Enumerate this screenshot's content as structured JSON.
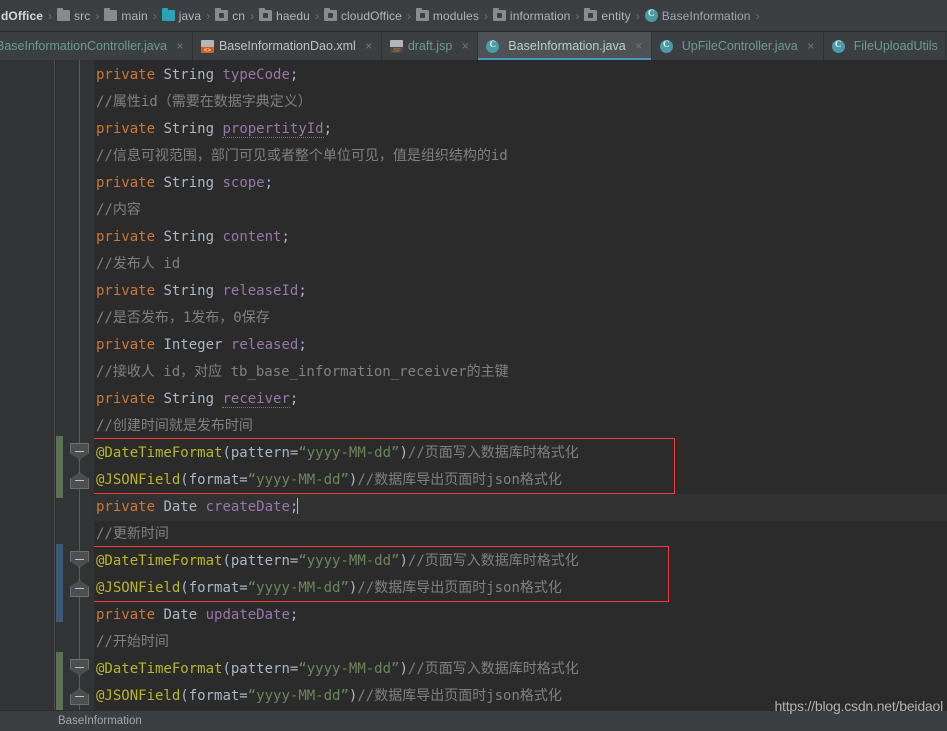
{
  "breadcrumb": {
    "items": [
      {
        "label": "dOffice",
        "icon": "folder-icon",
        "kind": "text"
      },
      {
        "label": "src",
        "icon": "folder-icon",
        "kind": "folder"
      },
      {
        "label": "main",
        "icon": "folder-icon",
        "kind": "folder"
      },
      {
        "label": "java",
        "icon": "source-folder-icon",
        "kind": "source"
      },
      {
        "label": "cn",
        "icon": "package-icon",
        "kind": "package"
      },
      {
        "label": "haedu",
        "icon": "package-icon",
        "kind": "package"
      },
      {
        "label": "cloudOffice",
        "icon": "package-icon",
        "kind": "package"
      },
      {
        "label": "modules",
        "icon": "package-icon",
        "kind": "package"
      },
      {
        "label": "information",
        "icon": "package-icon",
        "kind": "package"
      },
      {
        "label": "entity",
        "icon": "package-icon",
        "kind": "package"
      },
      {
        "label": "BaseInformation",
        "icon": "java-class-icon",
        "kind": "class"
      }
    ],
    "separator": "›"
  },
  "tabs": [
    {
      "label": "BaseInformationController.java",
      "icon": "java-class-icon",
      "type": "java",
      "active": false,
      "close": "×",
      "truncated": true
    },
    {
      "label": "BaseInformationDao.xml",
      "icon": "xml-file-icon",
      "type": "xml",
      "active": false,
      "close": "×"
    },
    {
      "label": "draft.jsp",
      "icon": "jsp-file-icon",
      "type": "jsp",
      "active": false,
      "close": "×"
    },
    {
      "label": "BaseInformation.java",
      "icon": "java-class-icon",
      "type": "java",
      "active": true,
      "close": "×"
    },
    {
      "label": "UpFileController.java",
      "icon": "java-class-icon",
      "type": "java",
      "active": false,
      "close": "×"
    },
    {
      "label": "FileUploadUtils",
      "icon": "java-class-icon",
      "type": "java",
      "active": false,
      "close": ""
    }
  ],
  "code": {
    "lines": [
      {
        "i": 0,
        "type": "field",
        "kw": "private",
        "typ": "String",
        "name": "typeCode",
        "semi": ";"
      },
      {
        "i": 1,
        "type": "comment",
        "text": "//属性id（需要在数据字典定义）"
      },
      {
        "i": 2,
        "type": "field",
        "kw": "private",
        "typ": "String",
        "name": "propertityId",
        "semi": ";",
        "spellwarn": true
      },
      {
        "i": 3,
        "type": "comment",
        "text": "//信息可视范围，部门可见或者整个单位可见，值是组织结构的id"
      },
      {
        "i": 4,
        "type": "field",
        "kw": "private",
        "typ": "String",
        "name": "scope",
        "semi": ";"
      },
      {
        "i": 5,
        "type": "comment",
        "text": "//内容"
      },
      {
        "i": 6,
        "type": "field",
        "kw": "private",
        "typ": "String",
        "name": "content",
        "semi": ";"
      },
      {
        "i": 7,
        "type": "comment",
        "text": "//发布人 id"
      },
      {
        "i": 8,
        "type": "field",
        "kw": "private",
        "typ": "String",
        "name": "releaseId",
        "semi": ";"
      },
      {
        "i": 9,
        "type": "comment",
        "text": "//是否发布，1发布，0保存"
      },
      {
        "i": 10,
        "type": "field",
        "kw": "private",
        "typ": "Integer",
        "name": "released",
        "semi": ";"
      },
      {
        "i": 11,
        "type": "comment",
        "text": "//接收人 id，对应 tb_base_information_receiver的主键"
      },
      {
        "i": 12,
        "type": "field",
        "kw": "private",
        "typ": "String",
        "name": "receiver",
        "semi": ";",
        "spellwarn": true
      },
      {
        "i": 13,
        "type": "comment",
        "text": "//创建时间就是发布时间"
      },
      {
        "i": 14,
        "type": "anno",
        "anno": "@DateTimeFormat",
        "open": "(",
        "attr": "pattern=",
        "str": "“yyyy-MM-dd”",
        "close": ")",
        "cmt": "//页面写入数据库时格式化"
      },
      {
        "i": 15,
        "type": "anno",
        "anno": "@JSONField",
        "open": "(",
        "attr": "format=",
        "str": "“yyyy-MM-dd”",
        "close": ")",
        "cmt": "//数据库导出页面时json格式化"
      },
      {
        "i": 16,
        "type": "field",
        "kw": "private",
        "typ": "Date",
        "name": "createDate",
        "semi": ";",
        "caret": true,
        "current": true
      },
      {
        "i": 17,
        "type": "comment",
        "text": "//更新时间"
      },
      {
        "i": 18,
        "type": "anno",
        "anno": "@DateTimeFormat",
        "open": "(",
        "attr": "pattern=",
        "str": "“yyyy-MM-dd”",
        "close": ")",
        "cmt": "//页面写入数据库时格式化"
      },
      {
        "i": 19,
        "type": "anno",
        "anno": "@JSONField",
        "open": "(",
        "attr": "format=",
        "str": "“yyyy-MM-dd”",
        "close": ")",
        "cmt": "//数据库导出页面时json格式化"
      },
      {
        "i": 20,
        "type": "field",
        "kw": "private",
        "typ": "Date",
        "name": "updateDate",
        "semi": ";"
      },
      {
        "i": 21,
        "type": "comment",
        "text": "//开始时间"
      },
      {
        "i": 22,
        "type": "anno",
        "anno": "@DateTimeFormat",
        "open": "(",
        "attr": "pattern=",
        "str": "“yyyy-MM-dd”",
        "close": ")",
        "cmt": "//页面写入数据库时格式化"
      },
      {
        "i": 23,
        "type": "anno",
        "anno": "@JSONField",
        "open": "(",
        "attr": "format=",
        "str": "“yyyy-MM-dd”",
        "close": ")",
        "cmt": "//数据库导出页面时json格式化"
      }
    ],
    "highlight_boxes": [
      {
        "top_line": 14,
        "bottom_line": 15
      },
      {
        "top_line": 18,
        "bottom_line": 19
      }
    ],
    "fold_regions": [
      {
        "top_line": 14,
        "bottom_line": 15,
        "changebar": "added"
      },
      {
        "top_line": 18,
        "bottom_line": 19,
        "changebar": "modified"
      },
      {
        "top_line": 22,
        "bottom_line": 23,
        "changebar": "added"
      }
    ]
  },
  "status": {
    "label": "BaseInformation"
  },
  "watermark": "https://blog.csdn.net/beidaol",
  "colors": {
    "editor_bg": "#2b2b2b",
    "chrome_bg": "#3c3f41",
    "gutter_bg": "#313335",
    "keyword": "#cc7832",
    "type": "#a9b7c6",
    "field": "#9876aa",
    "comment": "#808080",
    "annotation": "#bbb529",
    "string": "#6a8759",
    "tab_active_underline": "#4a95c4",
    "highlight_border": "#f03a3a",
    "changebar_added": "#5a7254",
    "changebar_modified": "#3b5a78"
  }
}
